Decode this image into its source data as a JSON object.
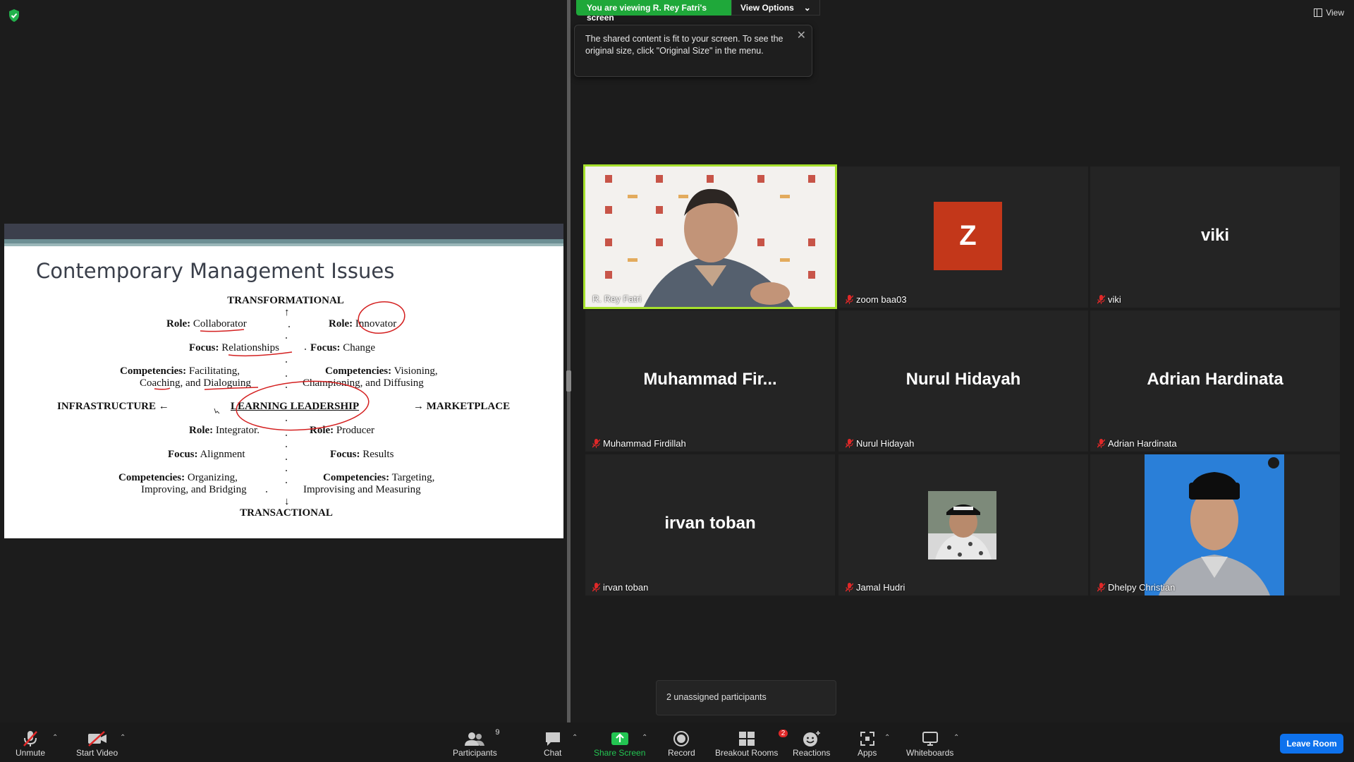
{
  "banner": {
    "viewing_text": "You are viewing R. Rey Fatri's screen",
    "view_options": "View Options",
    "tooltip": "The shared content is fit to your screen. To see the original size, click \"Original Size\" in the menu.",
    "view_label": "View"
  },
  "slide": {
    "title": "Contemporary Management Issues",
    "top": "TRANSFORMATIONAL",
    "bottom": "TRANSACTIONAL",
    "left": "INFRASTRUCTURE ←",
    "right": "→ MARKETPLACE",
    "center": "LEARNING LEADERSHIP",
    "q1_role_k": "Role:",
    "q1_role_v": "Collaborator",
    "q1_focus_k": "Focus:",
    "q1_focus_v": "Relationships",
    "q1_comp_k": "Competencies:",
    "q1_comp_v": "Facilitating,",
    "q1_comp_v2": "Coaching, and Dialoguing",
    "q2_role_k": "Role:",
    "q2_role_v": "Innovator",
    "q2_focus_k": "Focus:",
    "q2_focus_v": "Change",
    "q2_comp_k": "Competencies:",
    "q2_comp_v": "Visioning,",
    "q2_comp_v2": "Championing, and Diffusing",
    "q3_role_k": "Role:",
    "q3_role_v": "Integrator.",
    "q3_focus_k": "Focus:",
    "q3_focus_v": "Alignment",
    "q3_comp_k": "Competencies:",
    "q3_comp_v": "Organizing,",
    "q3_comp_v2": "Improving, and Bridging",
    "q4_role_k": "Role:",
    "q4_role_v": "Producer",
    "q4_focus_k": "Focus:",
    "q4_focus_v": "Results",
    "q4_comp_k": "Competencies:",
    "q4_comp_v": "Targeting,",
    "q4_comp_v2": "Improvising and Measuring"
  },
  "participants": [
    {
      "name": "R. Rey Fatri",
      "display": "",
      "muted": false,
      "type": "video"
    },
    {
      "name": "zoom baa03",
      "display": "Z",
      "muted": true,
      "type": "avatar"
    },
    {
      "name": "viki",
      "display": "viki",
      "muted": true,
      "type": "text"
    },
    {
      "name": "Muhammad Firdillah",
      "display": "Muhammad  Fir...",
      "muted": true,
      "type": "text"
    },
    {
      "name": "Nurul Hidayah",
      "display": "Nurul Hidayah",
      "muted": true,
      "type": "text"
    },
    {
      "name": "Adrian Hardinata",
      "display": "Adrian Hardinata",
      "muted": true,
      "type": "text"
    },
    {
      "name": "irvan toban",
      "display": "irvan toban",
      "muted": true,
      "type": "text"
    },
    {
      "name": "Jamal Hudri",
      "display": "",
      "muted": true,
      "type": "photo"
    },
    {
      "name": "Dhelpy Christian",
      "display": "",
      "muted": true,
      "type": "photo"
    }
  ],
  "toolbar": {
    "unmute": "Unmute",
    "start_video": "Start Video",
    "participants": "Participants",
    "participants_count": "9",
    "chat": "Chat",
    "share_screen": "Share Screen",
    "record": "Record",
    "breakout_rooms": "Breakout Rooms",
    "breakout_badge": "2",
    "reactions": "Reactions",
    "apps": "Apps",
    "whiteboards": "Whiteboards",
    "leave": "Leave Room"
  },
  "unassigned": "2 unassigned participants",
  "colors": {
    "active_speaker": "#a6e12c",
    "share_green": "#1fa83a",
    "leave_blue": "#0e72ed",
    "muted_red": "#e02828"
  }
}
